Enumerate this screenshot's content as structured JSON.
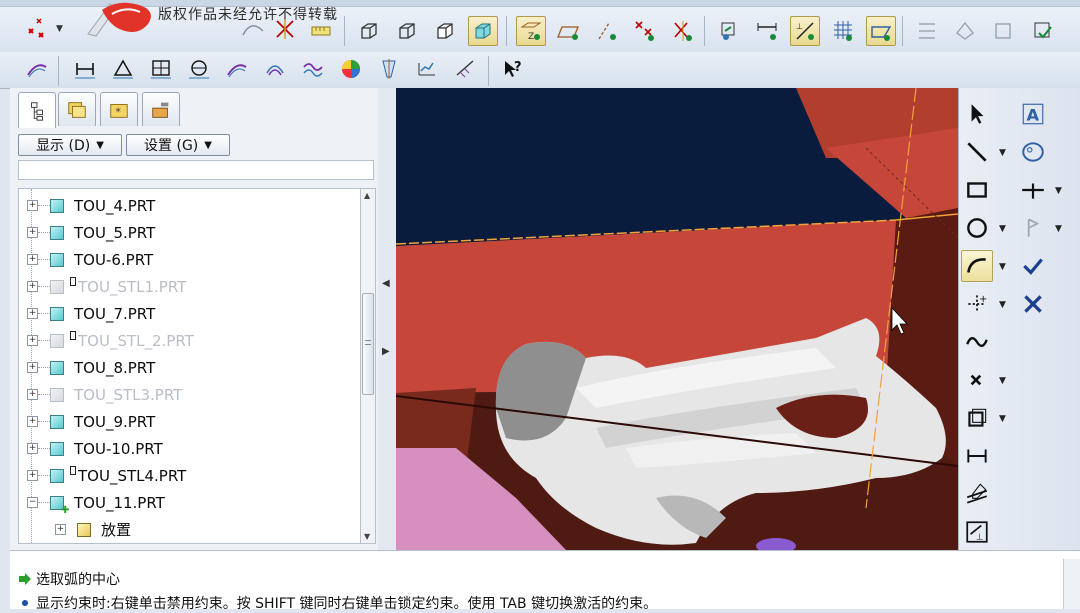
{
  "watermark": {
    "text": "版权作品未经允许不得转载"
  },
  "model_tree": {
    "display_menu": "显示 (D)",
    "settings_menu": "设置 (G)",
    "items": [
      {
        "label": "TOU_4.PRT",
        "state": "normal"
      },
      {
        "label": "TOU_5.PRT",
        "state": "normal"
      },
      {
        "label": "TOU-6.PRT",
        "state": "normal"
      },
      {
        "label": "TOU_STL1.PRT",
        "state": "suppressed"
      },
      {
        "label": "TOU_7.PRT",
        "state": "normal"
      },
      {
        "label": "TOU_STL_2.PRT",
        "state": "suppressed"
      },
      {
        "label": "TOU_8.PRT",
        "state": "normal"
      },
      {
        "label": "TOU_STL3.PRT",
        "state": "suppressed"
      },
      {
        "label": "TOU_9.PRT",
        "state": "normal"
      },
      {
        "label": "TOU-10.PRT",
        "state": "normal"
      },
      {
        "label": "TOU_STL4.PRT",
        "state": "normal-flag"
      },
      {
        "label": "TOU_11.PRT",
        "state": "expanded"
      },
      {
        "label": "放置",
        "state": "child"
      }
    ]
  },
  "status": {
    "line1": "选取弧的中心",
    "line2": "显示约束时:右键单击禁用约束。按 SHIFT 键同时右键单击锁定约束。使用 TAB 键切换激活的约束。"
  },
  "colors": {
    "viewport_bg": "#0a1c3e",
    "datum_plane": "#c6473a",
    "dark_plane": "#5a1b12",
    "accent_line": "#f2a23a",
    "toolbar_bg": "#dde6f0"
  }
}
